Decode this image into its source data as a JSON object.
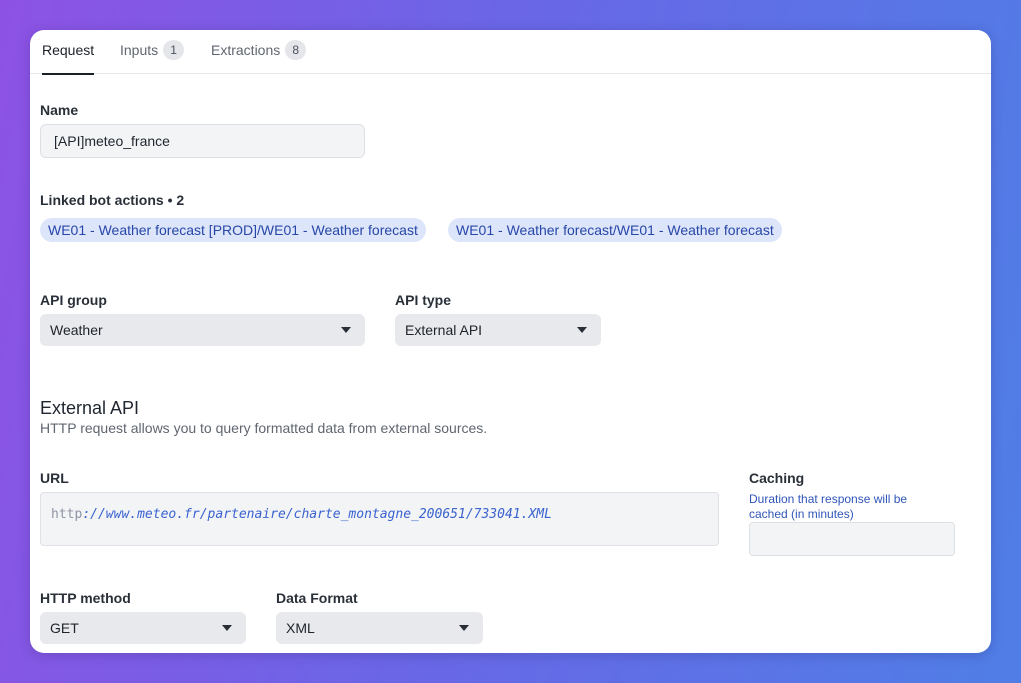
{
  "tabs": [
    {
      "label": "Request",
      "active": true
    },
    {
      "label": "Inputs",
      "count": "1"
    },
    {
      "label": "Extractions",
      "count": "8"
    }
  ],
  "name": {
    "label": "Name",
    "value": "[API]meteo_france"
  },
  "linked": {
    "label": "Linked bot actions • 2",
    "chips": [
      "WE01 - Weather forecast [PROD]/WE01 - Weather forecast",
      "WE01 - Weather forecast/WE01 - Weather forecast"
    ]
  },
  "api_group": {
    "label": "API group",
    "value": "Weather"
  },
  "api_type": {
    "label": "API type",
    "value": "External API"
  },
  "external": {
    "title": "External API",
    "description": "HTTP request allows you to query formatted data from external sources."
  },
  "url": {
    "label": "URL",
    "scheme": "http",
    "rest": "://www.meteo.fr/partenaire/charte_montagne_200651/733041.XML"
  },
  "caching": {
    "label": "Caching",
    "description": "Duration that response will be cached (in minutes)",
    "value": ""
  },
  "http_method": {
    "label": "HTTP method",
    "value": "GET"
  },
  "data_format": {
    "label": "Data Format",
    "value": "XML"
  },
  "colors": {
    "accent_chip_bg": "#dde5fb",
    "accent_chip_text": "#2747a8",
    "url_link": "#3a63d0"
  }
}
